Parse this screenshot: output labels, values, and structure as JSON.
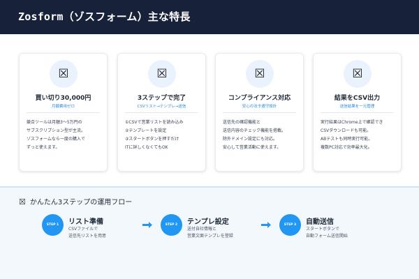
{
  "header": {
    "title": "Zosform（ゾスフォーム）主な特長"
  },
  "cards": [
    {
      "icon": "image-placeholder-icon",
      "title": "買い切り30,000円",
      "subtitle": "月額費用ゼロ",
      "body": [
        "競合ツールは月額3～5万円の",
        "サブスクリプション型が主流。",
        "ゾスフォームなら一度の購入で",
        "ずっと使えます。"
      ]
    },
    {
      "icon": "image-placeholder-icon",
      "title": "3ステップで完了",
      "subtitle": "CSVリスト→テンプレ→送信",
      "body": [
        "①CSVで営業リストを読み込み",
        "②テンプレートを設定",
        "③スタートボタンを押すだけ",
        "ITに詳しくなくてもOK"
      ]
    },
    {
      "icon": "image-placeholder-icon",
      "title": "コンプライアンス対応",
      "subtitle": "安心の法令遵守設計",
      "body": [
        "送信先の確認機能と",
        "送信内容のチェック機能を搭載。",
        "除外ドメイン設定にも対応。",
        "安心して営業活動に使えます。"
      ]
    },
    {
      "icon": "image-placeholder-icon",
      "title": "結果をCSV出力",
      "subtitle": "送信結果を一元管理",
      "body": [
        "実行結果はChrome上で確認でき",
        "CSVダウンロードも可能。",
        "ABテストも同時実行可能。",
        "複数PC対応で効率最大化。"
      ]
    }
  ],
  "flow": {
    "icon": "image-placeholder-icon",
    "title": "かんたん3ステップの運用フロー",
    "steps": [
      {
        "badge": "STEP 1",
        "title": "リスト準備",
        "desc": [
          "CSVファイルで",
          "送信先リストを用意"
        ]
      },
      {
        "badge": "STEP 2",
        "title": "テンプレ設定",
        "desc": [
          "送付自社情報と",
          "営業文面テンプレを登録"
        ]
      },
      {
        "badge": "STEP 3",
        "title": "自動送信",
        "desc": [
          "スタートボタンで",
          "自動フォーム送信開始"
        ]
      }
    ]
  },
  "colors": {
    "header_bg": "#17213a",
    "accent": "#2196f3",
    "subtitle": "#2b8bd6",
    "flow_bg": "#f3f8fd"
  }
}
